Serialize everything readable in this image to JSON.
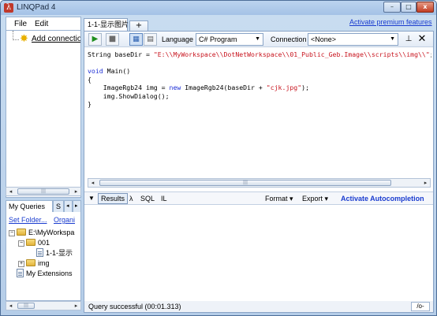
{
  "window": {
    "title": "LINQPad 4",
    "buttons": {
      "minimize": "–",
      "maximize": "□",
      "close": "x"
    }
  },
  "menu": {
    "file": "File",
    "edit": "Edit"
  },
  "connections": {
    "add_connection": "Add connection"
  },
  "queries_tabs": {
    "my_queries": "My Queries",
    "samples": "S",
    "nav_left": "◂",
    "nav_right": "▸"
  },
  "queries_links": {
    "set_folder": "Set Folder...",
    "organize": "Organi"
  },
  "tree": {
    "root": "E:\\MyWorkspa",
    "folder_001": "001",
    "query_file": "1-1-显示",
    "folder_img": "img",
    "my_extensions": "My Extensions"
  },
  "document_tab": {
    "label": "1-1-显示图片",
    "new_tab": "+"
  },
  "premium_link": "Activate premium features",
  "toolbar": {
    "language_label": "Language",
    "language_value": "C# Program",
    "connection_label": "Connection",
    "connection_value": "<None>"
  },
  "code": {
    "line1_pre": "String baseDir = ",
    "line1_str": "\"E:\\\\MyWorkspace\\\\DotNetWorkspace\\\\01_Public_Geb.Image\\\\scripts\\\\img\\\\\"",
    "line1_post": ";",
    "line3_kw": "void",
    "line3_rest": " Main()",
    "line4": "{",
    "line5_pre": "    ImageRgb24 img = ",
    "line5_kw": "new",
    "line5_mid": " ImageRgb24(baseDir + ",
    "line5_str": "\"cjk.jpg\"",
    "line5_post": ");",
    "line6": "    img.ShowDialog();",
    "line7": "}"
  },
  "results_bar": {
    "results": "Results",
    "lambda": "λ",
    "sql": "SQL",
    "il": "IL",
    "format": "Format ▾",
    "export": "Export ▾",
    "autocompletion": "Activate Autocompletion"
  },
  "status": {
    "text": "Query successful  (00:01.313)",
    "mode": "/o-"
  },
  "colors": {
    "accent_link": "#1a3ccf",
    "string": "#c8151f",
    "keyword": "#1d2fd6",
    "run_green": "#1e8e1e"
  },
  "icons": [
    "app-icon",
    "add-connection-icon",
    "run-icon",
    "stop-icon",
    "grid-results-icon",
    "pin-icon",
    "close-icon",
    "folder-icon",
    "document-icon"
  ]
}
